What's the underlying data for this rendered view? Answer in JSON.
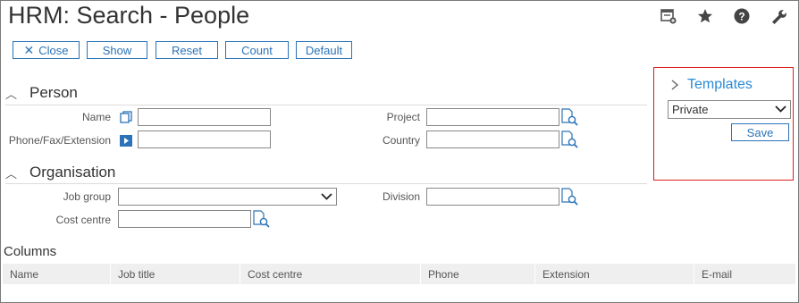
{
  "page": {
    "title": "HRM: Search - People"
  },
  "toolbar": {
    "close_label": "Close",
    "show_label": "Show",
    "reset_label": "Reset",
    "count_label": "Count",
    "default_label": "Default"
  },
  "top_icons": [
    "calendar-add-icon",
    "star-icon",
    "help-icon",
    "wrench-icon"
  ],
  "person": {
    "heading": "Person",
    "name_label": "Name",
    "phone_label": "Phone/Fax/Extension",
    "project_label": "Project",
    "country_label": "Country",
    "name_value": "",
    "phone_value": "",
    "project_value": "",
    "country_value": ""
  },
  "organisation": {
    "heading": "Organisation",
    "job_group_label": "Job group",
    "cost_centre_label": "Cost centre",
    "division_label": "Division",
    "job_group_value": "",
    "cost_centre_value": "",
    "division_value": ""
  },
  "columns": {
    "heading": "Columns",
    "headers": [
      "Name",
      "Job title",
      "Cost centre",
      "Phone",
      "Extension",
      "E-mail"
    ]
  },
  "templates": {
    "heading": "Templates",
    "selected": "Private",
    "save_label": "Save"
  },
  "colors": {
    "accent": "#2a73b8",
    "highlight_border": "#e01b1b"
  }
}
